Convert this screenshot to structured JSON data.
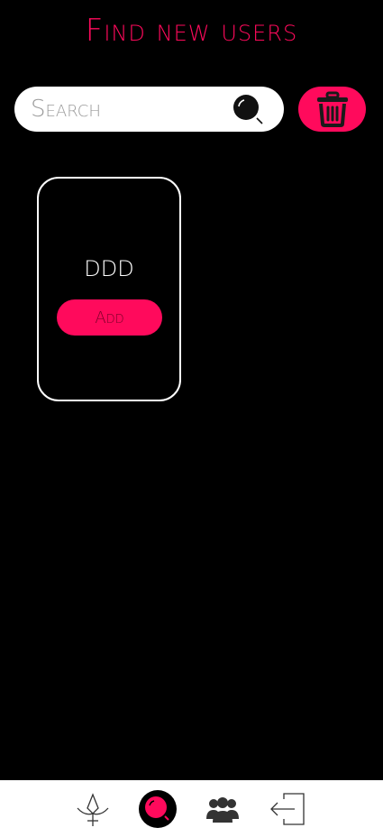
{
  "header": {
    "title": "Find new users"
  },
  "search": {
    "placeholder": "Search",
    "value": "",
    "icon": "search-icon"
  },
  "toolbar": {
    "clear_icon": "trash-icon"
  },
  "results": [
    {
      "name": "DDD",
      "add_label": "Add"
    }
  ],
  "bottom_nav": {
    "items": [
      {
        "icon": "home-icon",
        "active": false
      },
      {
        "icon": "search-icon",
        "active": true
      },
      {
        "icon": "users-icon",
        "active": false
      },
      {
        "icon": "logout-icon",
        "active": false
      }
    ]
  },
  "colors": {
    "accent": "#ff0a5c",
    "background": "#000000",
    "surface": "#ffffff"
  }
}
